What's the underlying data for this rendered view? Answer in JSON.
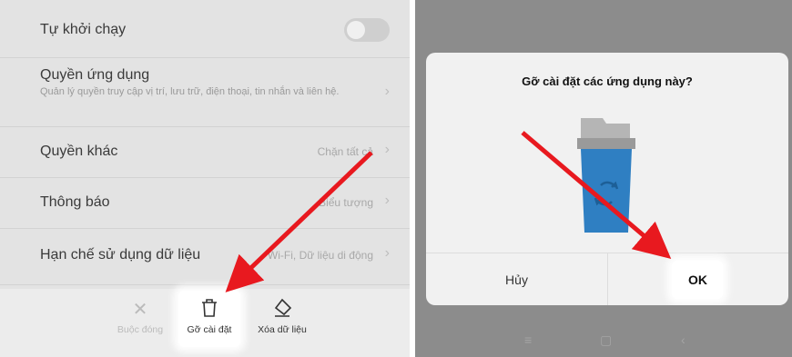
{
  "settings": {
    "rows": [
      {
        "title": "Tự khởi chạy"
      },
      {
        "title": "Quyền ứng dụng",
        "subtitle": "Quản lý quyền truy cập vị trí, lưu trữ, điện thoại, tin nhắn và liên hệ."
      },
      {
        "title": "Quyền khác",
        "value": "Chặn tất cả"
      },
      {
        "title": "Thông báo",
        "value": "Biểu tượng"
      },
      {
        "title": "Hạn chế sử dụng dữ liệu",
        "value": "Wi-Fi, Dữ liệu di động"
      }
    ],
    "toggle_on": false
  },
  "bottom_actions": {
    "force_stop": "Buộc đóng",
    "uninstall": "Gỡ cài đặt",
    "clear_data": "Xóa dữ liệu"
  },
  "dialog": {
    "title": "Gỡ cài đặt các ứng dụng này?",
    "cancel": "Hủy",
    "ok": "OK"
  },
  "colors": {
    "trash_blue": "#2f7fc2",
    "arrow_red": "#e8191f"
  }
}
